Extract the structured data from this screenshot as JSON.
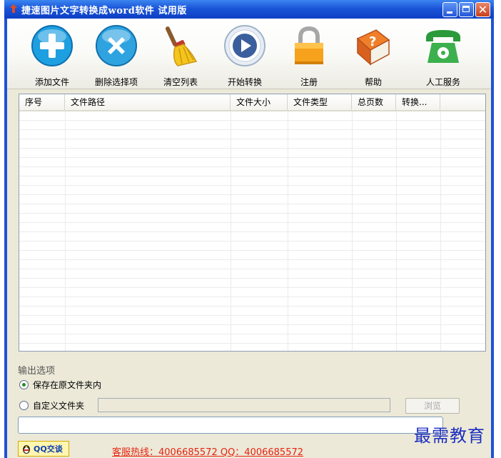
{
  "window": {
    "title": "捷速图片文字转换成word软件 试用版",
    "icon": "app-icon"
  },
  "toolbar": {
    "items": [
      {
        "label": "添加文件",
        "icon": "plus-circle-icon"
      },
      {
        "label": "删除选择项",
        "icon": "x-circle-icon"
      },
      {
        "label": "清空列表",
        "icon": "broom-icon"
      },
      {
        "label": "开始转换",
        "icon": "play-icon"
      },
      {
        "label": "注册",
        "icon": "lock-icon"
      },
      {
        "label": "帮助",
        "icon": "help-book-icon"
      },
      {
        "label": "人工服务",
        "icon": "telephone-icon"
      }
    ]
  },
  "file_table": {
    "columns": [
      "序号",
      "文件路径",
      "文件大小",
      "文件类型",
      "总页数",
      "转换..."
    ],
    "rows": []
  },
  "output_options": {
    "label": "输出选项",
    "save_in_original": "保存在原文件夹内",
    "custom_folder": "自定义文件夹",
    "selected": "保存在原文件夹内",
    "custom_path_value": "",
    "browse_label": "浏览"
  },
  "status_box": {
    "value": ""
  },
  "footer": {
    "qq_button": "QQ交谈",
    "hotline": "客服热线：4006685572 QQ：4006685572"
  },
  "watermark": "最需教育",
  "colors": {
    "titlebar": "#1a55d8",
    "client_bg": "#ece9d8",
    "hotline": "#e8220f",
    "watermark": "#1c2fc0"
  }
}
